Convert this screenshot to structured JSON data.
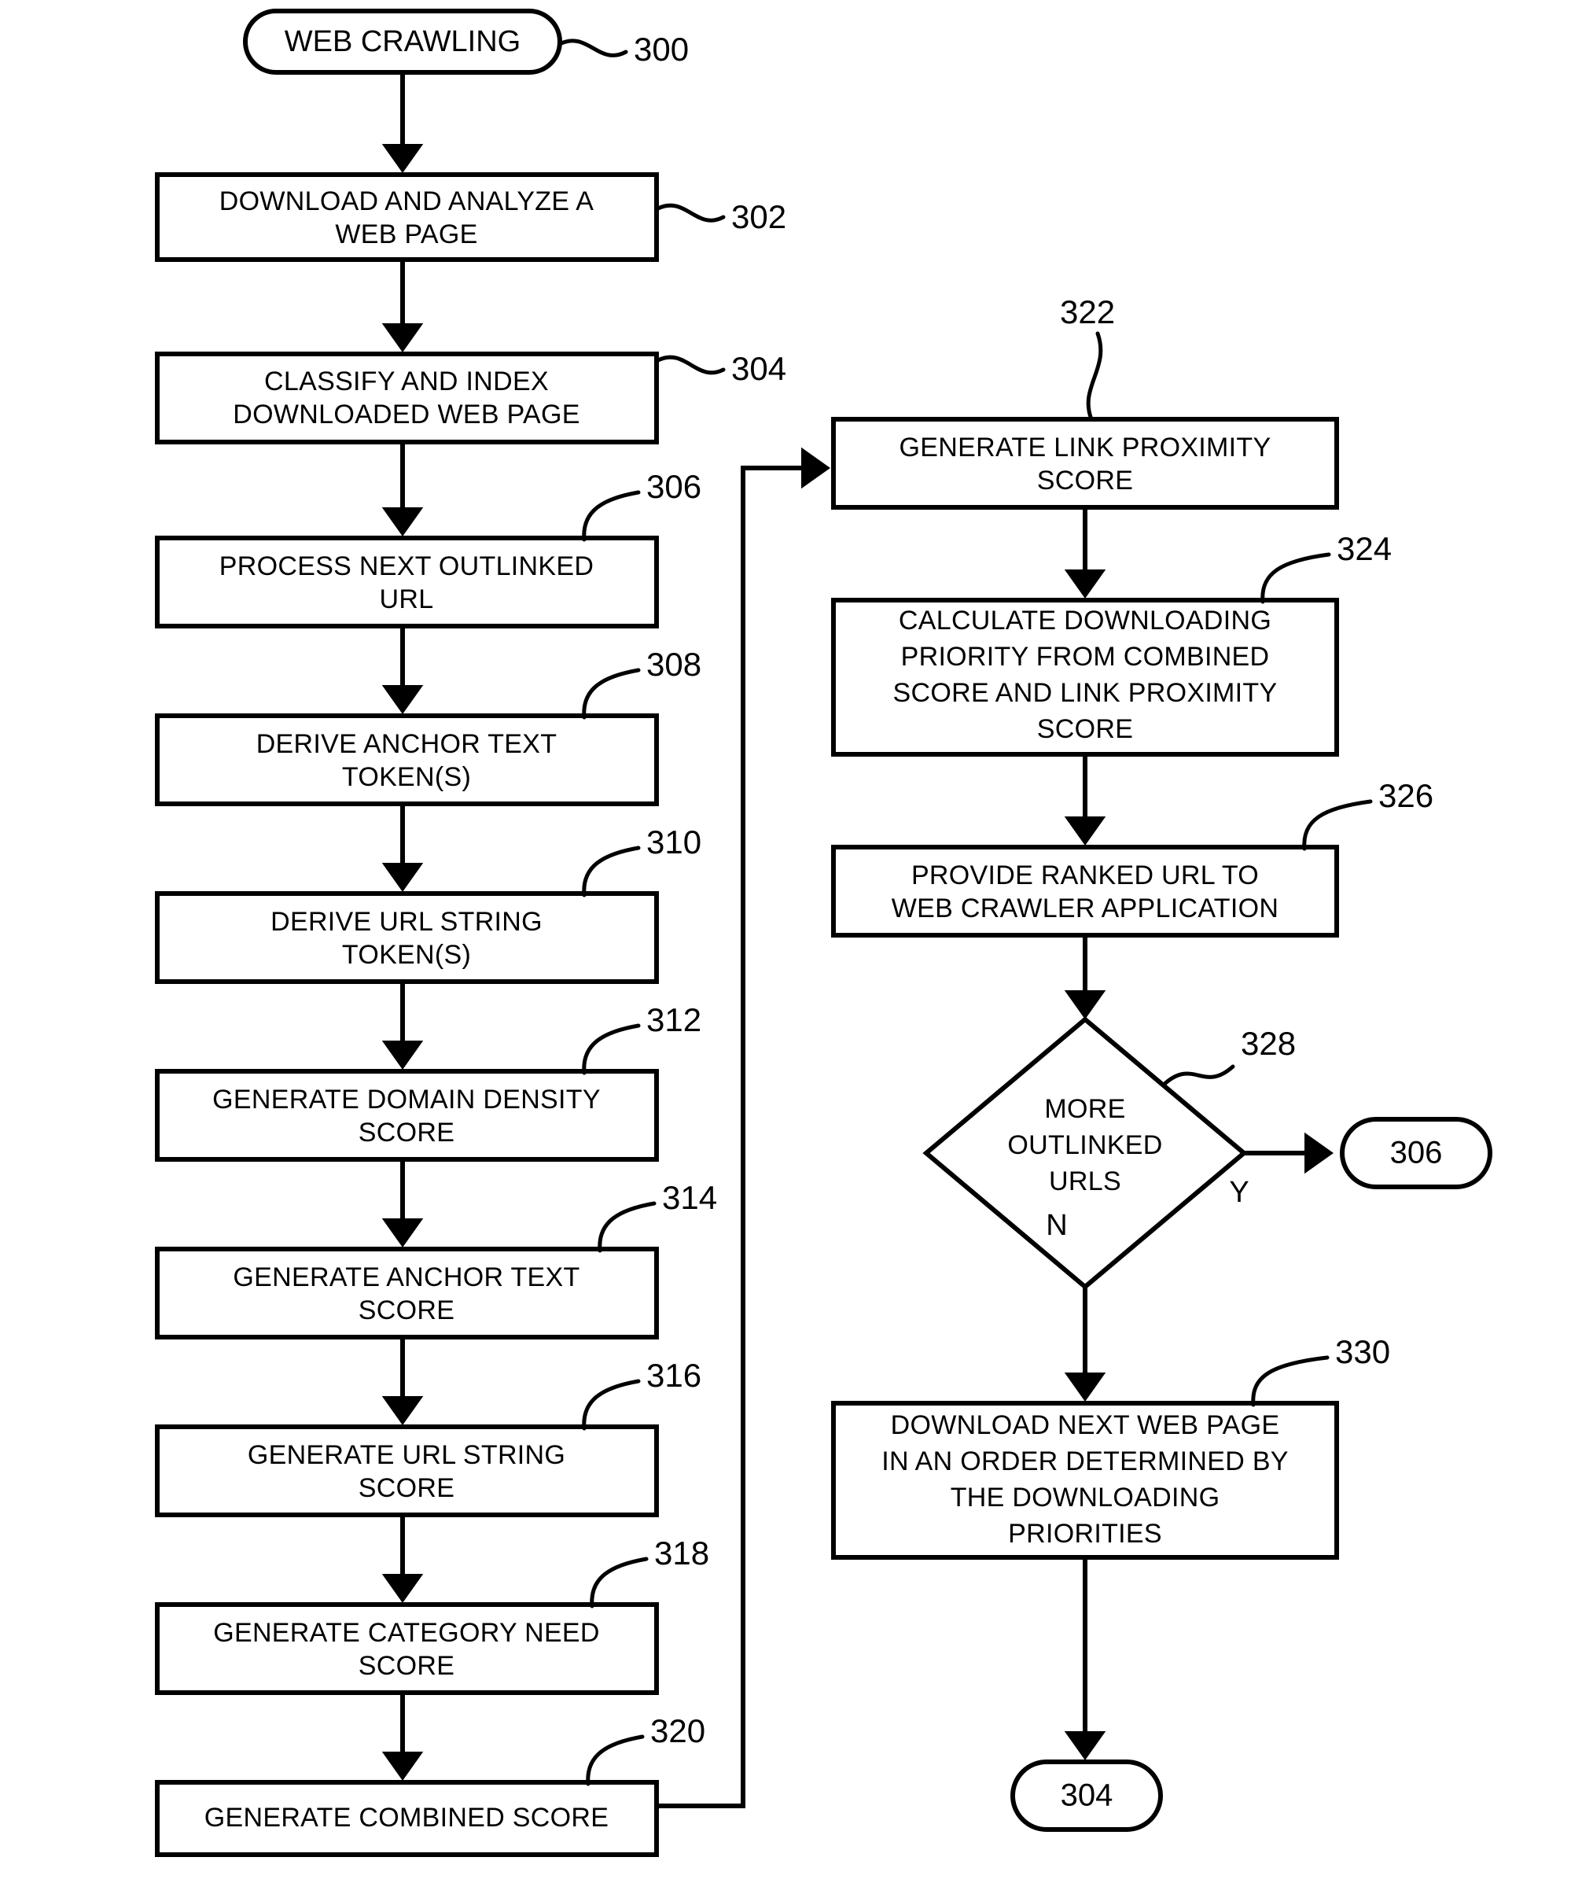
{
  "figure": {
    "type": "patent-flowchart",
    "background_color": "#ffffff",
    "stroke_color": "#000000"
  },
  "terminals": [
    {
      "id": "start",
      "label": "WEB CRAWLING",
      "ref": "300"
    }
  ],
  "left_column": {
    "steps": [
      {
        "ref": "302",
        "lines": [
          "DOWNLOAD AND ANALYZE A",
          "WEB PAGE"
        ]
      },
      {
        "ref": "304",
        "lines": [
          "CLASSIFY AND INDEX",
          "DOWNLOADED WEB PAGE"
        ]
      },
      {
        "ref": "306",
        "lines": [
          "PROCESS NEXT OUTLINKED",
          "URL"
        ]
      },
      {
        "ref": "308",
        "lines": [
          "DERIVE ANCHOR TEXT",
          "TOKEN(S)"
        ]
      },
      {
        "ref": "310",
        "lines": [
          "DERIVE URL STRING",
          "TOKEN(S)"
        ]
      },
      {
        "ref": "312",
        "lines": [
          "GENERATE DOMAIN DENSITY",
          "SCORE"
        ]
      },
      {
        "ref": "314",
        "lines": [
          "GENERATE ANCHOR TEXT",
          "SCORE"
        ]
      },
      {
        "ref": "316",
        "lines": [
          "GENERATE URL STRING",
          "SCORE"
        ]
      },
      {
        "ref": "318",
        "lines": [
          "GENERATE CATEGORY NEED",
          "SCORE"
        ]
      },
      {
        "ref": "320",
        "lines": [
          "GENERATE COMBINED SCORE"
        ]
      }
    ]
  },
  "right_column": {
    "steps": [
      {
        "ref": "322",
        "lines": [
          "GENERATE LINK PROXIMITY",
          "SCORE"
        ]
      },
      {
        "ref": "324",
        "lines": [
          "CALCULATE DOWNLOADING",
          "PRIORITY FROM COMBINED",
          "SCORE AND LINK PROXIMITY",
          "SCORE"
        ]
      },
      {
        "ref": "326",
        "lines": [
          "PROVIDE RANKED URL TO",
          "WEB CRAWLER APPLICATION"
        ]
      }
    ],
    "decision": {
      "ref": "328",
      "lines": [
        "MORE",
        "OUTLINKED",
        "URLS"
      ],
      "yes_label": "Y",
      "no_label": "N",
      "yes_target": "306"
    },
    "final_step": {
      "ref": "330",
      "lines": [
        "DOWNLOAD NEXT WEB PAGE",
        "IN AN ORDER DETERMINED BY",
        "THE DOWNLOADING",
        "PRIORITIES"
      ]
    },
    "exit_connector": "304"
  },
  "connectors": [
    {
      "id": "conn-306",
      "label": "306"
    },
    {
      "id": "conn-304",
      "label": "304"
    }
  ]
}
